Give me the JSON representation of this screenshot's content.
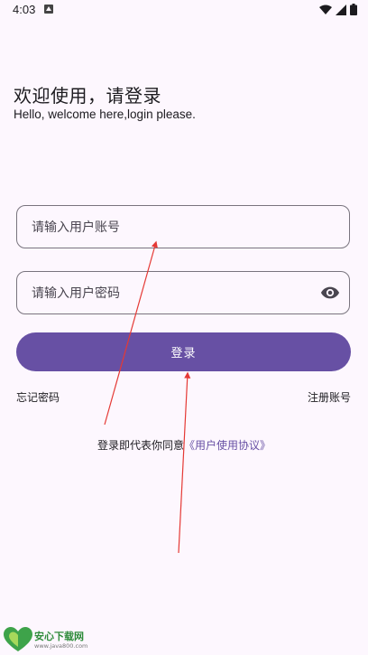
{
  "status_bar": {
    "time": "4:03"
  },
  "welcome": {
    "title": "欢迎使用，请登录",
    "subtitle": "Hello, welcome here,login please."
  },
  "form": {
    "username_placeholder": "请输入用户账号",
    "password_placeholder": "请输入用户密码",
    "login_label": "登录",
    "forgot_password": "忘记密码",
    "register": "注册账号"
  },
  "agreement": {
    "prefix": "登录即代表你同意",
    "link": "《用户使用协议》"
  },
  "icons": {
    "password_toggle": "eye-icon",
    "wifi": "wifi-icon",
    "signal": "signal-icon",
    "battery": "battery-icon"
  },
  "colors": {
    "primary": "#6750a4",
    "background": "#fdf7fe",
    "annotation_arrow": "#e53935"
  },
  "watermark": {
    "name": "安心下载网",
    "url": "www.java800.com"
  }
}
